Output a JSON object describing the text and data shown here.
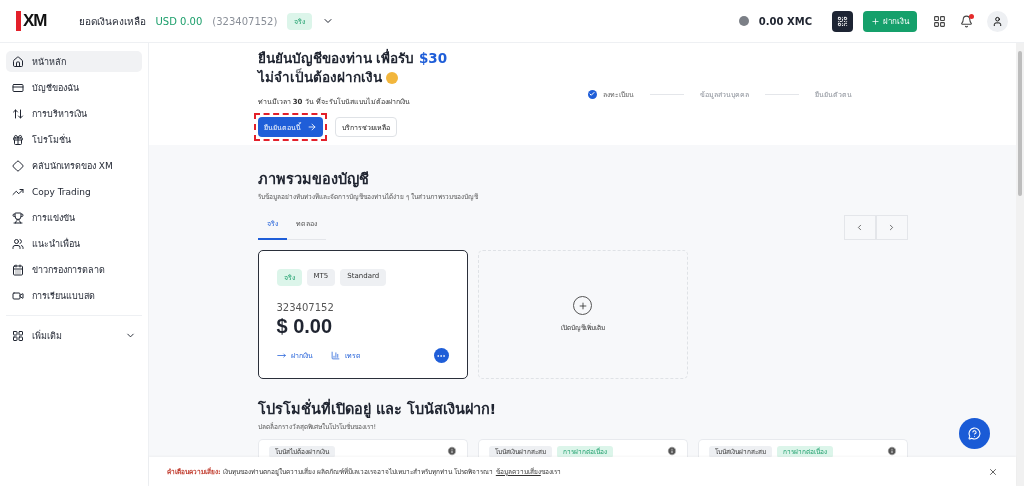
{
  "header": {
    "logo": "XM",
    "balance_label": "ยอดเงินคงเหลือ",
    "balance": "USD 0.00",
    "account_id": "(323407152)",
    "account_badge": "จริง",
    "coins": "0.00 XMC",
    "deposit_button": "ฝากเงิน",
    "has_notification": true
  },
  "sidebar": {
    "items": [
      {
        "label": "หน้าหลัก",
        "selected": true
      },
      {
        "label": "บัญชีของฉัน",
        "selected": false
      },
      {
        "label": "การบริหารเงิน",
        "selected": false
      },
      {
        "label": "โปรโมชั่น",
        "selected": false
      },
      {
        "label": "คลับนักเทรดของ XM",
        "selected": false
      },
      {
        "label": "Copy Trading",
        "selected": false
      },
      {
        "label": "การแข่งขัน",
        "selected": false
      },
      {
        "label": "แนะนำเพื่อน",
        "selected": false
      },
      {
        "label": "ข่าวกรองการตลาด",
        "selected": false
      },
      {
        "label": "การเรียนแบบสด",
        "selected": false
      }
    ],
    "more": {
      "label": "เพิ่มเติม",
      "expanded": false
    }
  },
  "banner": {
    "title_start": "ยืนยันบัญชีของท่าน เพื่อรับ",
    "title_highlight": "$30",
    "title_end": "ไม่จำเป็นต้องฝากเงิน",
    "subtitle": "ท่านมีเวลา **30** วัน ที่จะรับโบนัสแบบไม่ต้องฝากเงิน",
    "primary_button": "ยืนยันตอนนี้",
    "secondary_button": "บริการช่วยเหลือ",
    "highlighted": true,
    "steps": [
      {
        "label": "ลงทะเบียน",
        "done": true
      },
      {
        "label": "ข้อมูลส่วนบุคคล",
        "done": false
      },
      {
        "label": "ยืนยันตัวตน",
        "done": false
      }
    ]
  },
  "overview": {
    "title": "ภาพรวมของบัญชี",
    "subtitle": "รับข้อมูลอย่างทันท่วงทีและจัดการบัญชีของท่านได้ง่าย ๆ ในส่วนภาพรวมของบัญชี",
    "tabs": [
      {
        "label": "จริง",
        "selected": true
      },
      {
        "label": "ทดลอง",
        "selected": false
      }
    ],
    "account": {
      "tags": [
        "จริง",
        "MT5",
        "Standard"
      ],
      "number": "323407152",
      "balance": "$ 0.00",
      "deposit": "ฝากเงิน",
      "trade": "เทรด"
    },
    "add_account": "เปิดบัญชีเพิ่มเติม"
  },
  "promotions": {
    "title": "โปรโมชั่นที่เปิดอยู่ และ โบนัสเงินฝาก!",
    "subtitle": "ปลดล็อกรางวัลสุดพิเศษในโปรโมชั่นของเรา!",
    "cards": [
      {
        "tags": [
          "โบนัสไม่ต้องฝากเงิน"
        ]
      },
      {
        "tags": [
          "โบนัสเงินฝากสะสม",
          "การฝากต่อเนื่อง"
        ]
      },
      {
        "tags": [
          "โบนัสเงินฝากสะสม",
          "การฝากต่อเนื่อง"
        ]
      }
    ]
  },
  "risk_bar": {
    "label": "คำเตือนความเสี่ยง:",
    "text": "เงินทุนของท่านตกอยู่ในความเสี่ยง ผลิตภัณฑ์ที่มีเลเวอเรจอาจไม่เหมาะสำหรับทุกท่าน โปรดพิจารณา",
    "link": "ข้อมูลความเสี่ยง",
    "text_end": "ของเรา"
  }
}
